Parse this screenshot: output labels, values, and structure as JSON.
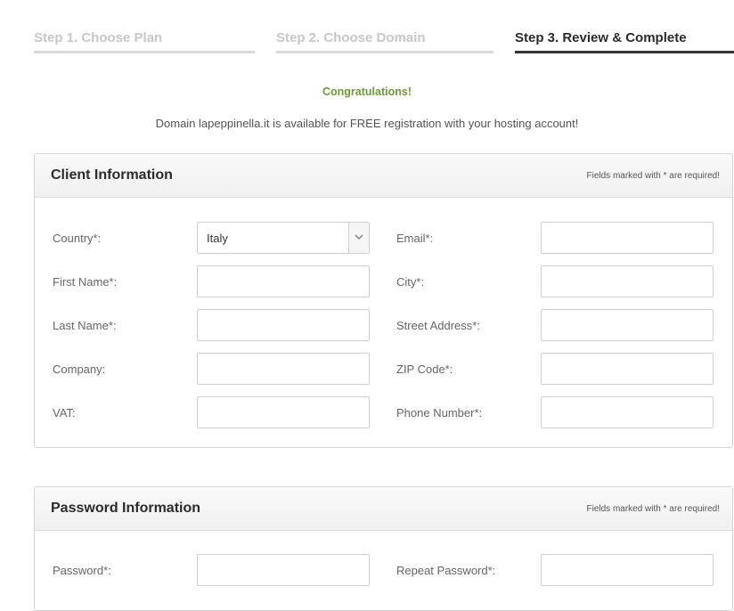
{
  "steps": [
    {
      "label": "Step 1. Choose Plan",
      "state": "inactive"
    },
    {
      "label": "Step 2. Choose Domain",
      "state": "inactive"
    },
    {
      "label": "Step 3. Review & Complete",
      "state": "active"
    }
  ],
  "notice": {
    "heading": "Congratulations!",
    "message": "Domain lapeppinella.it is available for FREE registration with your hosting account!"
  },
  "client": {
    "title": "Client Information",
    "required_note": "Fields marked with * are required!",
    "labels": {
      "country": "Country*:",
      "first_name": "First Name*:",
      "last_name": "Last Name*:",
      "company": "Company:",
      "vat": "VAT:",
      "email": "Email*:",
      "city": "City*:",
      "street": "Street Address*:",
      "zip": "ZIP Code*:",
      "phone": "Phone Number*:"
    },
    "country_value": "Italy"
  },
  "password": {
    "title": "Password Information",
    "required_note": "Fields marked with * are required!",
    "labels": {
      "password": "Password*:",
      "repeat": "Repeat Password*:"
    }
  },
  "colors": {
    "congrats": "#6c9a3a",
    "active_step": "#333333",
    "inactive_step": "#c7c7c7"
  }
}
